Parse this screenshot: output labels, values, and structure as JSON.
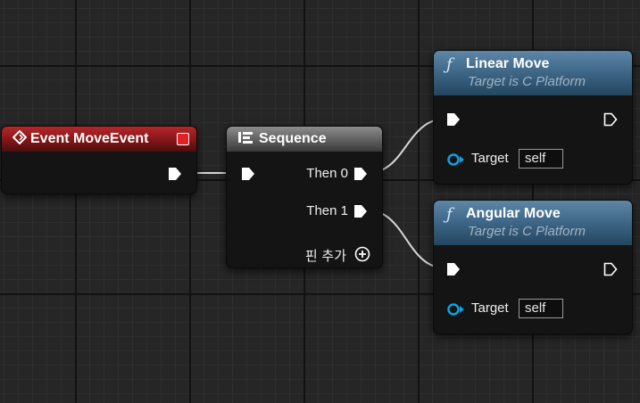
{
  "graph": {
    "event_node": {
      "title": "Event MoveEvent",
      "icon": "event-diamond-icon",
      "delegate_icon": "delegate-square-icon",
      "accent": "#b5272a"
    },
    "sequence_node": {
      "title": "Sequence",
      "icon": "sequence-icon",
      "outputs": [
        "Then 0",
        "Then 1"
      ],
      "add_pin_label": "핀 추가"
    },
    "function_nodes": [
      {
        "title": "Linear Move",
        "subtitle": "Target is C Platform",
        "icon": "function-icon",
        "target_label": "Target",
        "target_value": "self"
      },
      {
        "title": "Angular Move",
        "subtitle": "Target is C Platform",
        "icon": "function-icon",
        "target_label": "Target",
        "target_value": "self"
      }
    ],
    "colors": {
      "exec_pin": "#ffffff",
      "object_pin": "#0da1e6",
      "function_header": "#3d6585"
    }
  }
}
